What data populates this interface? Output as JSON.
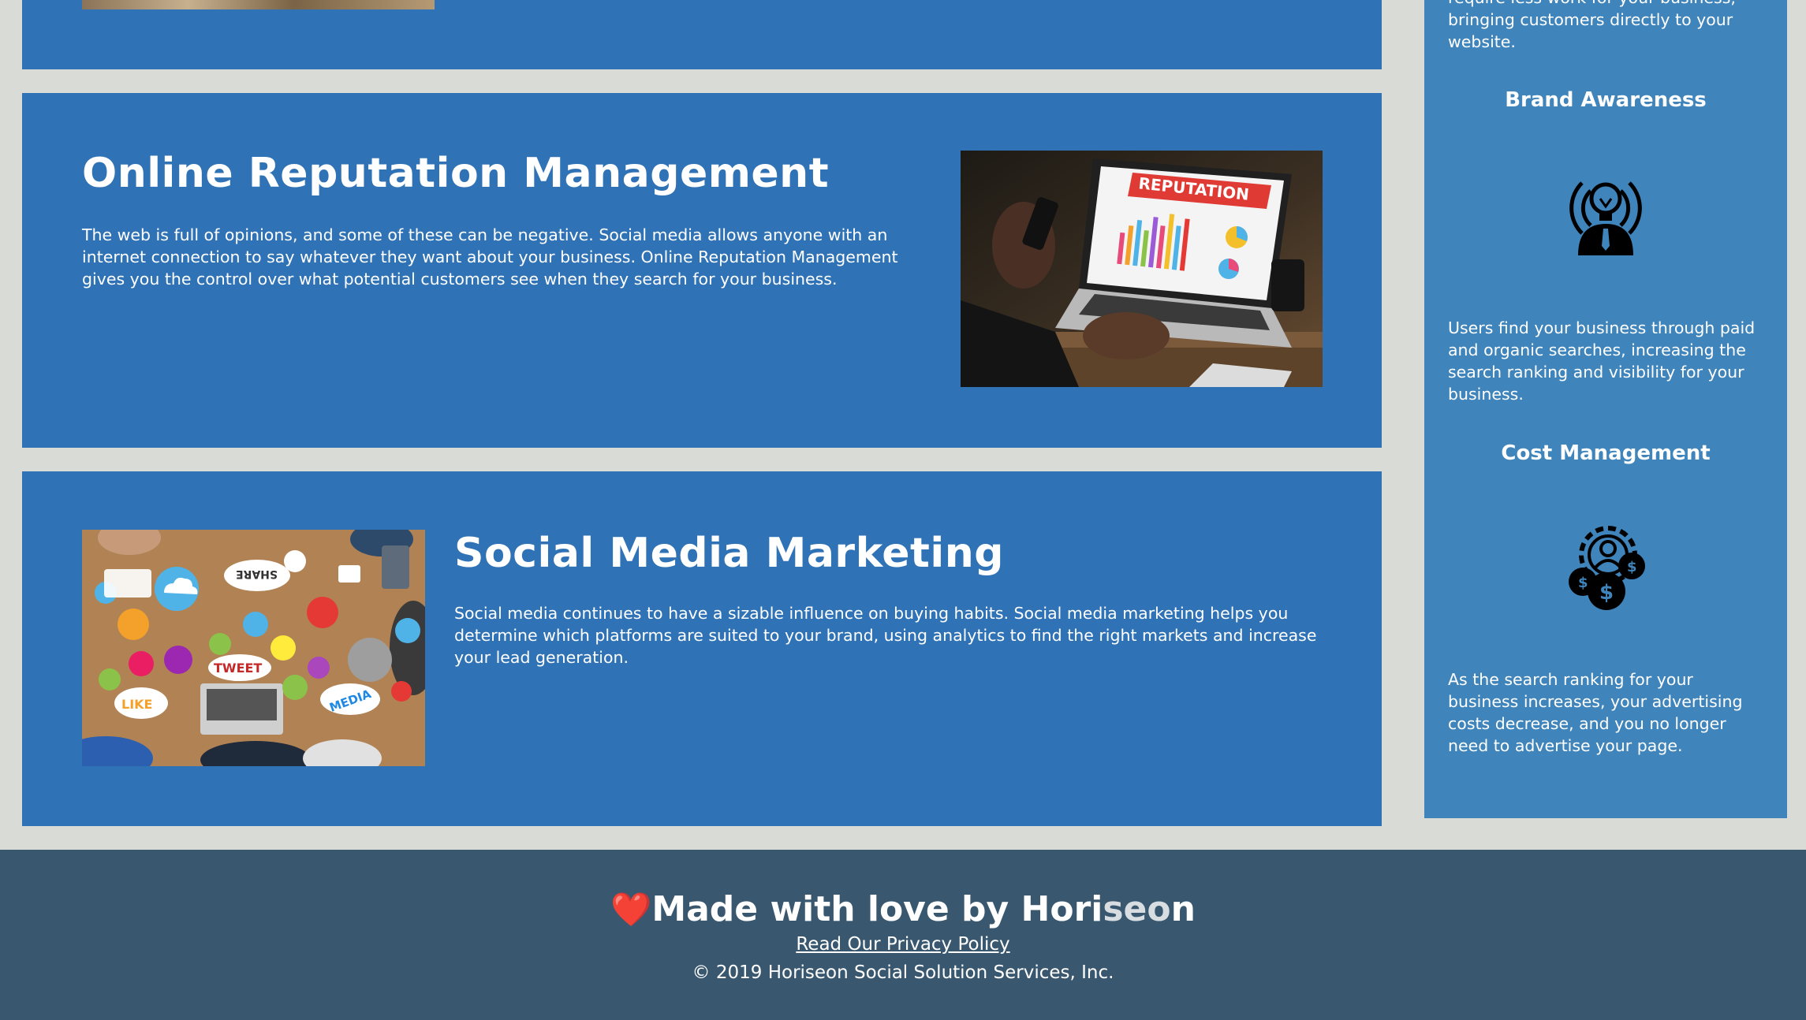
{
  "sections": {
    "orm": {
      "title": "Online Reputation Management",
      "text": "The web is full of opinions, and some of these can be negative. Social media allows anyone with an internet connection to say whatever they want about your business. Online Reputation Management gives you the control over what potential customers see when they search for your business.",
      "image_label": "REPUTATION"
    },
    "smm": {
      "title": "Social Media Marketing",
      "text": "Social media continues to have a sizable influence on buying habits. Social media marketing helps you determine which platforms are suited to your brand, using analytics to find the right markets and increase your lead generation.",
      "image_words": [
        "SHARE",
        "TWEET",
        "LIKE",
        "MEDIA"
      ]
    }
  },
  "sidebar": {
    "intro_text": "require less work for your business, bringing customers directly to your website.",
    "benefits": [
      {
        "heading": "Brand Awareness",
        "icon": "brand-awareness-icon",
        "text": "Users find your business through paid and organic searches, increasing the search ranking and visibility for your business."
      },
      {
        "heading": "Cost Management",
        "icon": "cost-management-icon",
        "text": "As the search ranking for your business increases, your advertising costs decrease, and you no longer need to advertise your page."
      }
    ]
  },
  "footer": {
    "heart": "❤️",
    "title_main": "Made with love by Hori",
    "title_fade": "seo",
    "title_end": "n",
    "privacy_link": "Read Our Privacy Policy",
    "copyright": "© 2019 Horiseon Social Solution Services, Inc."
  },
  "colors": {
    "page_background": "#d9dcd6",
    "card_background": "#2f72b6",
    "sidebar_background": "#3f84bb",
    "footer_background": "#39586f",
    "heart": "#e0322f"
  }
}
